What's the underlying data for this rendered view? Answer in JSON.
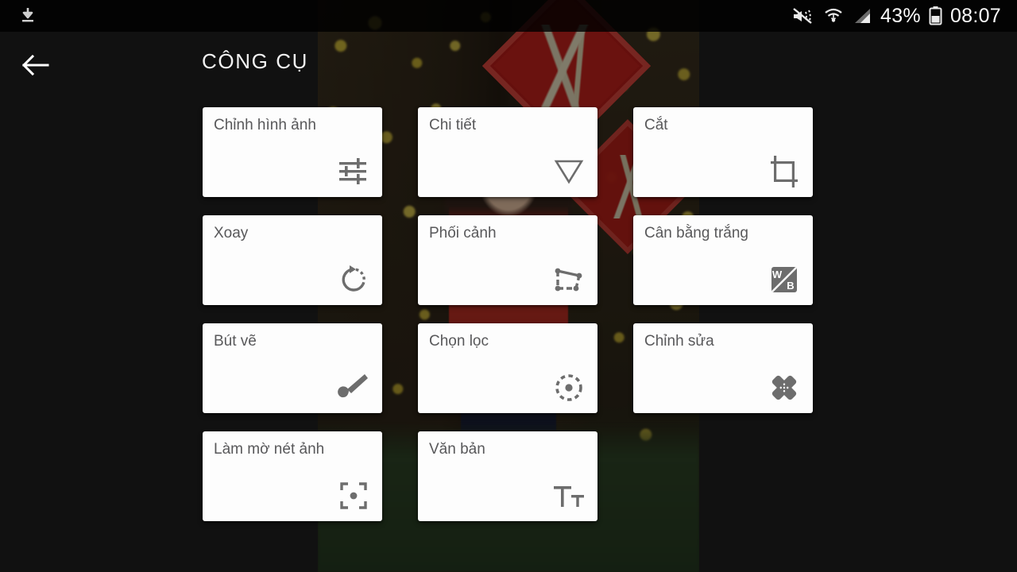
{
  "status_bar": {
    "download_icon": "download-icon",
    "vibrate_mute_icon": "vibrate-mute-icon",
    "wifi_icon": "wifi-icon",
    "signal_icon": "cell-signal-icon",
    "battery_percent": "43%",
    "battery_icon": "battery-icon",
    "time": "08:07"
  },
  "header": {
    "back_icon": "back-arrow-icon",
    "title": "CÔNG CỤ"
  },
  "colors": {
    "panel_bg": "#111111",
    "card_bg": "#fdfdfd",
    "card_label": "#58585a",
    "card_icon": "#6d6d6d",
    "status_text": "#fbfbfb"
  },
  "tools": [
    {
      "label": "Chỉnh hình ảnh",
      "icon": "tune-sliders-icon",
      "name": "tool-chinh-hinh-anh"
    },
    {
      "label": "Chi tiết",
      "icon": "details-triangle-icon",
      "name": "tool-chi-tiet"
    },
    {
      "label": "Cắt",
      "icon": "crop-icon",
      "name": "tool-cat"
    },
    {
      "label": "Xoay",
      "icon": "rotate-icon",
      "name": "tool-xoay"
    },
    {
      "label": "Phối cảnh",
      "icon": "perspective-icon",
      "name": "tool-phoi-canh"
    },
    {
      "label": "Cân bằng trắng",
      "icon": "white-balance-wb-icon",
      "name": "tool-can-bang-trang"
    },
    {
      "label": "Bút vẽ",
      "icon": "brush-icon",
      "name": "tool-but-ve"
    },
    {
      "label": "Chọn lọc",
      "icon": "selective-dashed-circle-icon",
      "name": "tool-chon-loc"
    },
    {
      "label": "Chỉnh sửa",
      "icon": "healing-bandage-icon",
      "name": "tool-chinh-sua"
    },
    {
      "label": "Làm mờ nét ảnh",
      "icon": "vignette-brackets-icon",
      "name": "tool-lam-mo-net-anh"
    },
    {
      "label": "Văn bản",
      "icon": "text-tt-icon",
      "name": "tool-van-ban"
    }
  ]
}
